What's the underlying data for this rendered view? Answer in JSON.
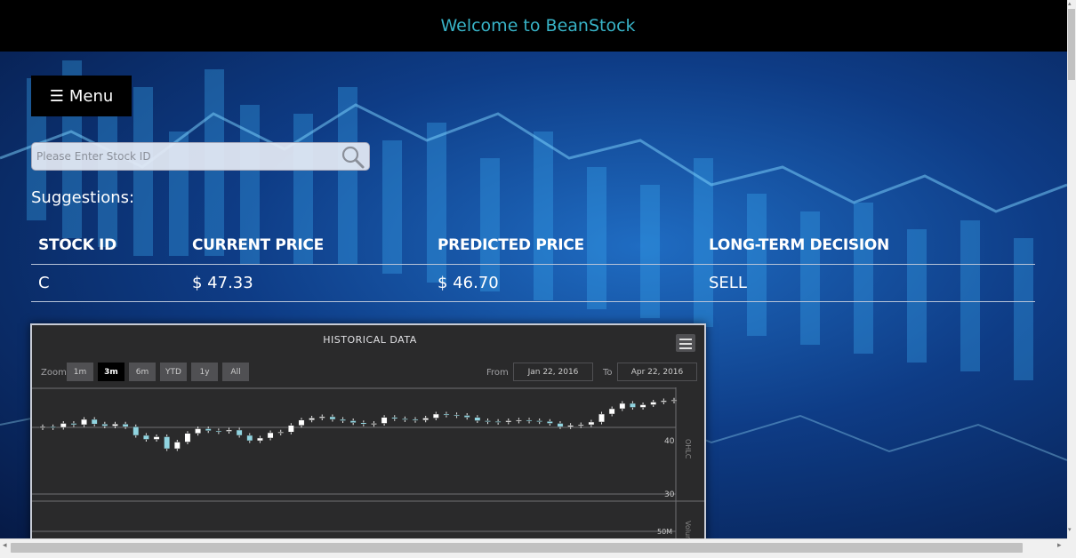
{
  "header": {
    "title": "Welcome to BeanStock"
  },
  "menu": {
    "icon": "hamburger-icon",
    "label": "Menu"
  },
  "search": {
    "placeholder": "Please Enter Stock ID",
    "icon": "search-icon"
  },
  "suggestions": {
    "title": "Suggestions:",
    "columns": [
      "STOCK ID",
      "CURRENT PRICE",
      "PREDICTED PRICE",
      "LONG-TERM DECISION"
    ],
    "rows": [
      {
        "stock_id": "C",
        "current_price": "$ 47.33",
        "predicted_price": "$ 46.70",
        "decision": "SELL"
      }
    ]
  },
  "chart": {
    "title": "HISTORICAL DATA",
    "zoom_label": "Zoom",
    "zoom_buttons": [
      "1m",
      "3m",
      "6m",
      "YTD",
      "1y",
      "All"
    ],
    "active_zoom": "3m",
    "from_label": "From",
    "from_date": "Jan 22, 2016",
    "to_label": "To",
    "to_date": "Apr 22, 2016",
    "colors": {
      "background": "#2a2a2b",
      "up": "#ffffff",
      "down": "#90d4e0"
    }
  },
  "chart_data": {
    "type": "candlestick",
    "title": "HISTORICAL DATA",
    "y_axis_label": "OHLC",
    "y_ticks": [
      30,
      40
    ],
    "volume_axis_label": "Volume",
    "volume_ticks": [
      "50M"
    ],
    "ylim": [
      30,
      46
    ],
    "x_range": [
      "Jan 22, 2016",
      "Apr 22, 2016"
    ],
    "closes": [
      40.1,
      40.0,
      40.6,
      40.4,
      41.2,
      40.5,
      40.2,
      40.5,
      40.1,
      38.8,
      38.2,
      38.6,
      36.8,
      37.8,
      39.1,
      39.8,
      39.5,
      39.4,
      39.6,
      38.8,
      38.0,
      38.4,
      39.2,
      39.3,
      40.3,
      41.1,
      41.4,
      41.6,
      41.2,
      41.0,
      40.7,
      40.5,
      40.6,
      41.5,
      41.3,
      41.2,
      41.1,
      41.4,
      42.0,
      41.9,
      41.8,
      41.5,
      41.0,
      40.9,
      40.8,
      41.0,
      41.1,
      41.0,
      40.9,
      40.6,
      40.1,
      40.3,
      40.4,
      40.8,
      42.0,
      42.8,
      43.6,
      43.0,
      43.4,
      43.8,
      44.0,
      44.1
    ]
  },
  "scrollbars": {
    "left_arrow": "◂",
    "right_arrow": "▸",
    "up_arrow": "▴",
    "down_arrow": "▾"
  }
}
